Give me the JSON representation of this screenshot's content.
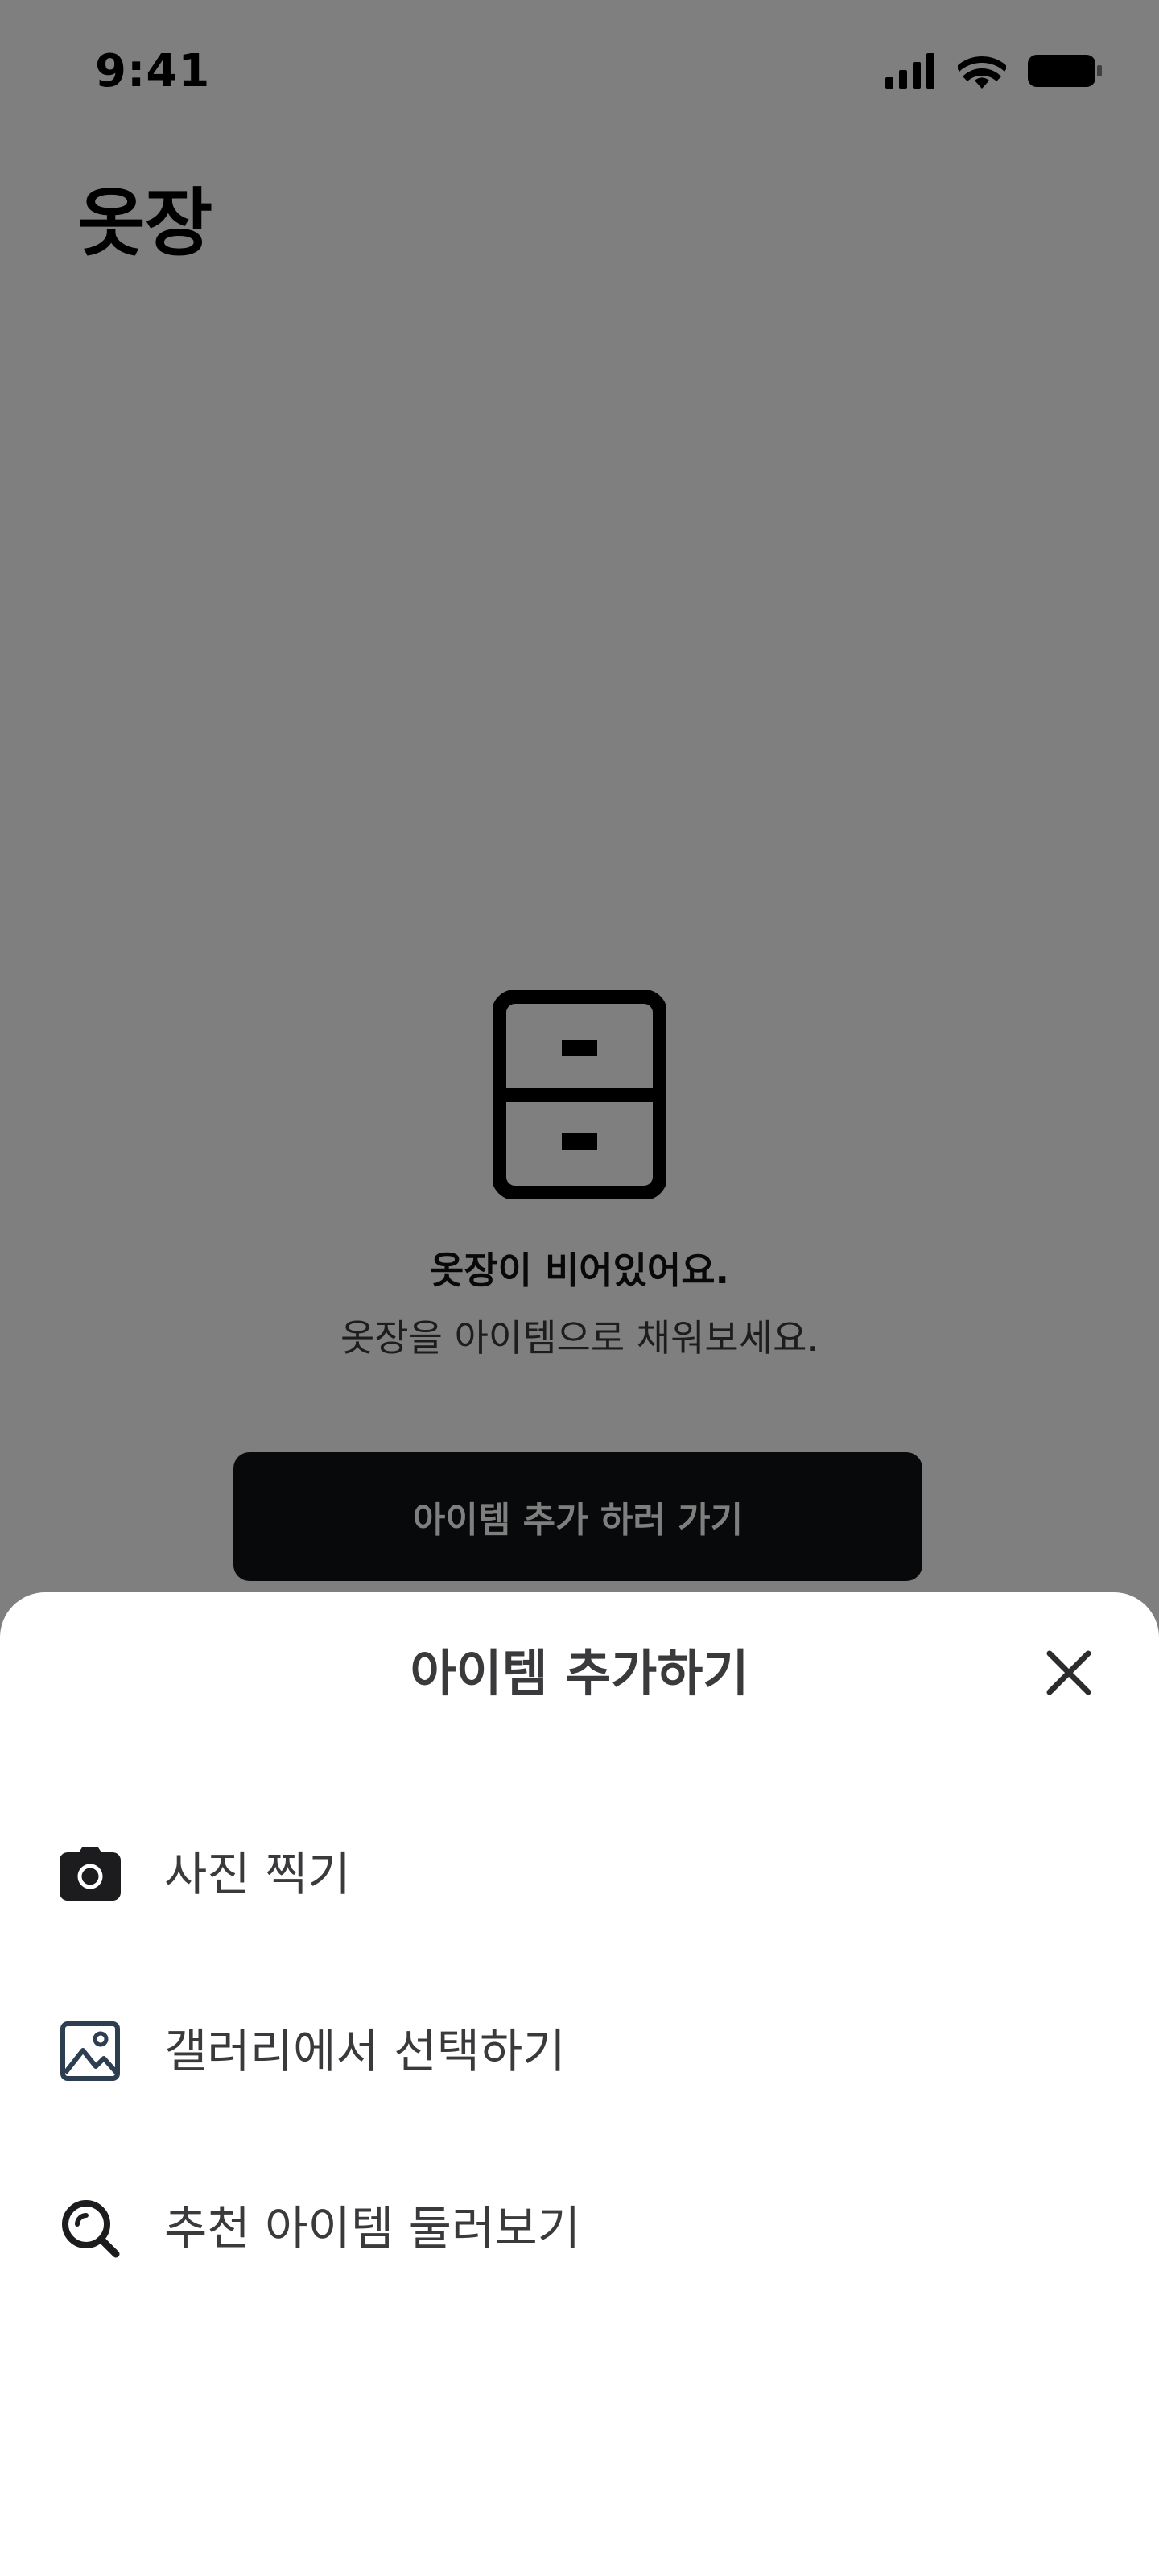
{
  "status_bar": {
    "time": "9:41",
    "icons": [
      "signal-icon",
      "wifi-icon",
      "battery-icon"
    ]
  },
  "header": {
    "title": "옷장"
  },
  "empty_state": {
    "icon": "cabinet-icon",
    "title": "옷장이 비어있어요.",
    "subtitle": "옷장을 아이템으로 채워보세요.",
    "cta_label": "아이템 추가 하러 가기"
  },
  "sheet": {
    "title": "아이템 추가하기",
    "close_icon": "close-icon",
    "items": [
      {
        "icon": "camera-icon",
        "label": "사진 찍기"
      },
      {
        "icon": "image-icon",
        "label": "갤러리에서 선택하기"
      },
      {
        "icon": "search-icon",
        "label": "추천 아이템 둘러보기"
      }
    ]
  },
  "colors": {
    "cta_background": "#111214",
    "scrim": "rgba(0,0,0,0.5)",
    "sheet_background": "#ffffff",
    "text_primary": "#3a3a3c"
  }
}
